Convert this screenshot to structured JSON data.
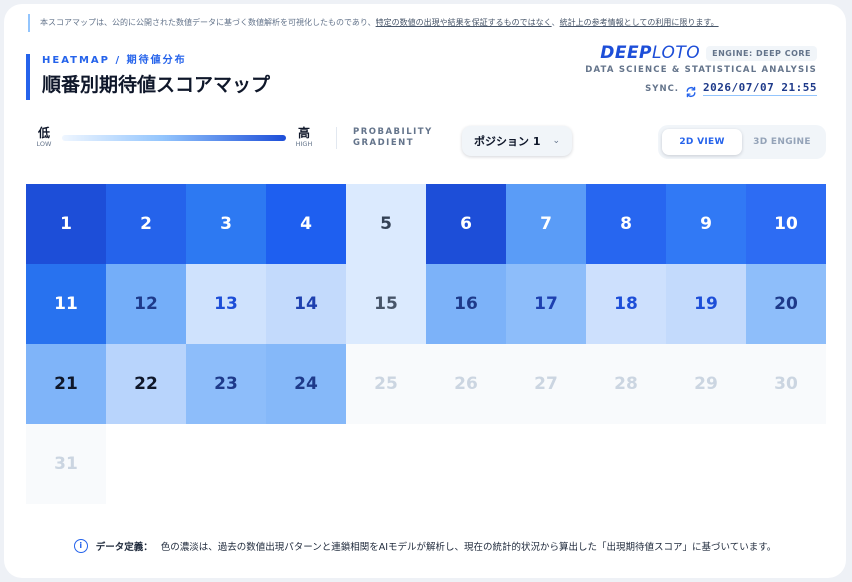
{
  "notice": {
    "prefix": "本スコアマップは、公的に公開された数値データに基づく数値解析を可視化したものであり、",
    "underline1": "特定の数値の出現や結果を保証するものではなく",
    "middle": "、",
    "underline2": "統計上の参考情報としての利用に限ります。"
  },
  "header": {
    "eyebrow": "HEATMAP / 期待値分布",
    "title": "順番別期待値スコアマップ"
  },
  "brand": {
    "logo_bold": "DEEP",
    "logo_light": "LOTO",
    "engine": "ENGINE: DEEP CORE",
    "subtitle": "DATA SCIENCE & STATISTICAL ANALYSIS",
    "sync_label": "SYNC.",
    "sync_time": "2026/07/07 21:55"
  },
  "legend": {
    "low_big": "低",
    "low_small": "LOW",
    "high_big": "高",
    "high_small": "HIGH",
    "gradient_line1": "PROBABILITY",
    "gradient_line2": "GRADIENT"
  },
  "position_select": {
    "value": "ポジション 1"
  },
  "view_toggle": {
    "view_2d": "2D VIEW",
    "view_3d": "3D ENGINE",
    "active": "2D VIEW"
  },
  "heatmap": {
    "cells": [
      {
        "n": "1",
        "bg": "#1d4ed8",
        "fg": "#ffffff"
      },
      {
        "n": "2",
        "bg": "#2563eb",
        "fg": "#ffffff"
      },
      {
        "n": "3",
        "bg": "#2d79f2",
        "fg": "#ffffff"
      },
      {
        "n": "4",
        "bg": "#1e5ff0",
        "fg": "#ffffff"
      },
      {
        "n": "5",
        "bg": "#dbeafe",
        "fg": "#334155"
      },
      {
        "n": "6",
        "bg": "#1d4ed8",
        "fg": "#ffffff"
      },
      {
        "n": "7",
        "bg": "#5a9cf7",
        "fg": "#ffffff"
      },
      {
        "n": "8",
        "bg": "#2766f0",
        "fg": "#ffffff"
      },
      {
        "n": "9",
        "bg": "#3179f5",
        "fg": "#ffffff"
      },
      {
        "n": "10",
        "bg": "#2d6cf3",
        "fg": "#ffffff"
      },
      {
        "n": "11",
        "bg": "#2872ef",
        "fg": "#ffffff"
      },
      {
        "n": "12",
        "bg": "#74aef9",
        "fg": "#1e3a8a"
      },
      {
        "n": "13",
        "bg": "#cfe2fd",
        "fg": "#1d4ed8"
      },
      {
        "n": "14",
        "bg": "#c3dafc",
        "fg": "#1e40af"
      },
      {
        "n": "15",
        "bg": "#dbeafe",
        "fg": "#475569"
      },
      {
        "n": "16",
        "bg": "#7cb2f9",
        "fg": "#1e3a8a"
      },
      {
        "n": "17",
        "bg": "#8dbdfa",
        "fg": "#1e40af"
      },
      {
        "n": "18",
        "bg": "#cde0fd",
        "fg": "#1d4ed8"
      },
      {
        "n": "19",
        "bg": "#c3dafc",
        "fg": "#1d4ed8"
      },
      {
        "n": "20",
        "bg": "#8ebefa",
        "fg": "#1e3a8a"
      },
      {
        "n": "21",
        "bg": "#7fb4f9",
        "fg": "#0f172a"
      },
      {
        "n": "22",
        "bg": "#b8d4fc",
        "fg": "#0f172a"
      },
      {
        "n": "23",
        "bg": "#8dbdfa",
        "fg": "#1e3a8a"
      },
      {
        "n": "24",
        "bg": "#85b8f9",
        "fg": "#1e3a8a"
      },
      {
        "n": "25",
        "bg": "#f8fafc",
        "fg": "#cbd5e1"
      },
      {
        "n": "26",
        "bg": "#f8fafc",
        "fg": "#cbd5e1"
      },
      {
        "n": "27",
        "bg": "#f8fafc",
        "fg": "#cbd5e1"
      },
      {
        "n": "28",
        "bg": "#f8fafc",
        "fg": "#cbd5e1"
      },
      {
        "n": "29",
        "bg": "#f8fafc",
        "fg": "#cbd5e1"
      },
      {
        "n": "30",
        "bg": "#f8fafc",
        "fg": "#cbd5e1"
      },
      {
        "n": "31",
        "bg": "#f8fafc",
        "fg": "#cbd5e1"
      }
    ]
  },
  "footer": {
    "label": "データ定義：",
    "text": "色の濃淡は、過去の数値出現パターンと連鎖相関をAIモデルが解析し、現在の統計的状況から算出した「出現期待値スコア」に基づいています。"
  }
}
